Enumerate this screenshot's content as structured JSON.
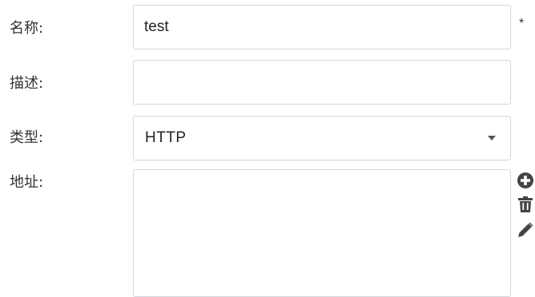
{
  "form": {
    "name": {
      "label": "名称:",
      "value": "test",
      "required_mark": "*"
    },
    "description": {
      "label": "描述:",
      "value": ""
    },
    "type": {
      "label": "类型:",
      "selected": "HTTP"
    },
    "address": {
      "label": "地址:",
      "value": ""
    }
  },
  "icons": {
    "add": "plus-circle-icon",
    "delete": "trash-icon",
    "edit": "pencil-icon"
  },
  "colors": {
    "border": "#d2d6dc",
    "icon": "#444444",
    "text": "#333333"
  }
}
